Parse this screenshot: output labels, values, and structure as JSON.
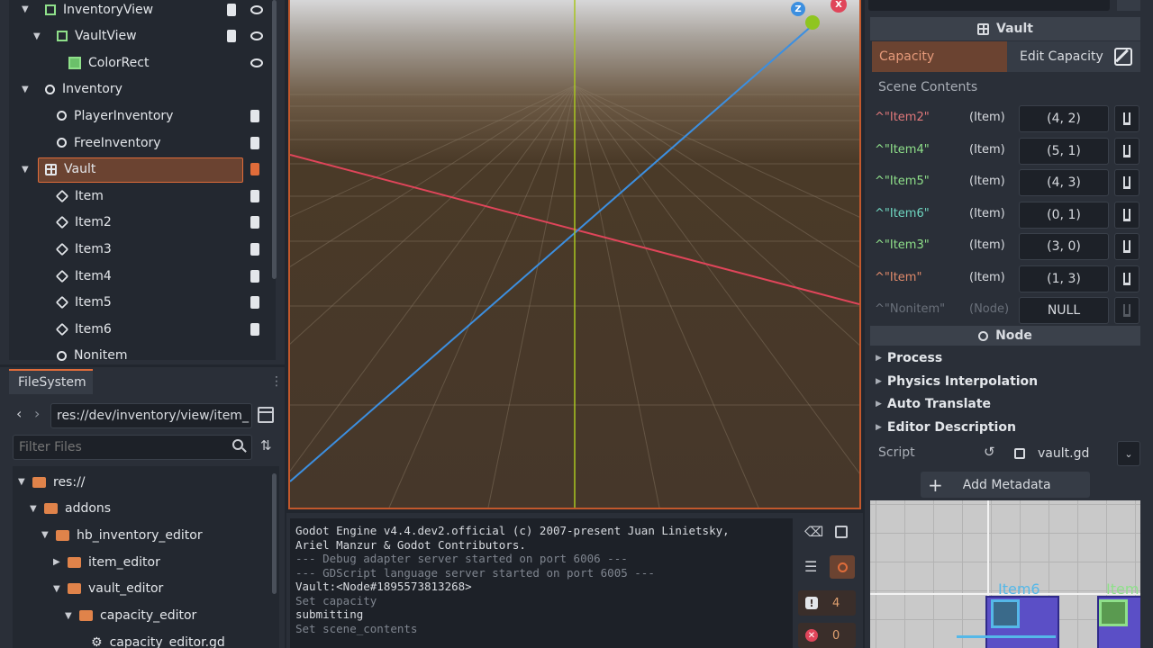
{
  "scene_tree": {
    "items": [
      {
        "label": "InventoryView",
        "icon": "control-node-icon",
        "depth": 1,
        "script": true,
        "visible": true,
        "expanded": true
      },
      {
        "label": "VaultView",
        "icon": "control-node-icon",
        "depth": 2,
        "script": true,
        "visible": true,
        "expanded": true
      },
      {
        "label": "ColorRect",
        "icon": "color-rect-icon",
        "depth": 3,
        "script": false,
        "visible": true
      },
      {
        "label": "Inventory",
        "icon": "node-icon",
        "depth": 1,
        "script": false,
        "visible": false,
        "expanded": true
      },
      {
        "label": "PlayerInventory",
        "icon": "node-icon",
        "depth": 2,
        "script": true,
        "visible": false
      },
      {
        "label": "FreeInventory",
        "icon": "node-icon",
        "depth": 2,
        "script": true,
        "visible": false
      },
      {
        "label": "Vault",
        "icon": "grid-icon",
        "depth": 1,
        "script": true,
        "visible": false,
        "expanded": true,
        "selected": true
      },
      {
        "label": "Item",
        "icon": "cube-icon",
        "depth": 2,
        "script": true,
        "visible": false
      },
      {
        "label": "Item2",
        "icon": "cube-icon",
        "depth": 2,
        "script": true,
        "visible": false
      },
      {
        "label": "Item3",
        "icon": "cube-icon",
        "depth": 2,
        "script": true,
        "visible": false
      },
      {
        "label": "Item4",
        "icon": "cube-icon",
        "depth": 2,
        "script": true,
        "visible": false
      },
      {
        "label": "Item5",
        "icon": "cube-icon",
        "depth": 2,
        "script": true,
        "visible": false
      },
      {
        "label": "Item6",
        "icon": "cube-icon",
        "depth": 2,
        "script": true,
        "visible": false
      },
      {
        "label": "Nonitem",
        "icon": "node-icon",
        "depth": 2,
        "script": false,
        "visible": false
      }
    ]
  },
  "filesystem": {
    "tab_label": "FileSystem",
    "path": "res://dev/inventory/view/item_",
    "filter_placeholder": "Filter Files",
    "items": [
      {
        "label": "res://",
        "depth": 0,
        "type": "folder"
      },
      {
        "label": "addons",
        "depth": 1,
        "type": "folder"
      },
      {
        "label": "hb_inventory_editor",
        "depth": 2,
        "type": "folder"
      },
      {
        "label": "item_editor",
        "depth": 3,
        "type": "folder",
        "collapsed": true
      },
      {
        "label": "vault_editor",
        "depth": 3,
        "type": "folder"
      },
      {
        "label": "capacity_editor",
        "depth": 4,
        "type": "folder"
      },
      {
        "label": "capacity_editor.gd",
        "depth": 5,
        "type": "script"
      }
    ]
  },
  "output": {
    "lines": [
      {
        "text": "Godot Engine v4.4.dev2.official (c) 2007-present Juan Linietsky,",
        "style": "bright"
      },
      {
        "text": "Ariel Manzur & Godot Contributors.",
        "style": "bright"
      },
      {
        "text": "--- Debug adapter server started on port 6006 ---",
        "style": "dim"
      },
      {
        "text": "--- GDScript language server started on port 6005 ---",
        "style": "dim"
      },
      {
        "text": "Vault:<Node#1895573813268>",
        "style": "bright"
      },
      {
        "text": "Set capacity",
        "style": "dim"
      },
      {
        "text": "submitting",
        "style": "bright"
      },
      {
        "text": "Set scene_contents",
        "style": "dim"
      }
    ],
    "warning_count": "4",
    "error_count": "0"
  },
  "inspector": {
    "node_title": "Vault",
    "capacity_label": "Capacity",
    "edit_capacity_label": "Edit Capacity",
    "scene_contents_label": "Scene Contents",
    "contents": [
      {
        "name": "^\"Item2\"",
        "type": "(Item)",
        "value": "(4, 2)",
        "color": "#e0787a"
      },
      {
        "name": "^\"Item4\"",
        "type": "(Item)",
        "value": "(5, 1)",
        "color": "#8fe08a"
      },
      {
        "name": "^\"Item5\"",
        "type": "(Item)",
        "value": "(4, 3)",
        "color": "#8fe08a"
      },
      {
        "name": "^\"Item6\"",
        "type": "(Item)",
        "value": "(0, 1)",
        "color": "#6fd6c0"
      },
      {
        "name": "^\"Item3\"",
        "type": "(Item)",
        "value": "(3, 0)",
        "color": "#8fe08a"
      },
      {
        "name": "^\"Item\"",
        "type": "(Item)",
        "value": "(1, 3)",
        "color": "#e08a6a"
      },
      {
        "name": "^\"Nonitem\"",
        "type": "(Node)",
        "value": "NULL",
        "color": "#6a707a"
      }
    ],
    "node_section": "Node",
    "sections": [
      "Process",
      "Physics Interpolation",
      "Auto Translate",
      "Editor Description"
    ],
    "script_label": "Script",
    "script_value": "vault.gd",
    "add_metadata": "Add Metadata",
    "preview_labels": [
      "Item6",
      "Item"
    ]
  },
  "colors": {
    "accent": "#e06c3a",
    "selected_bg": "#6b4331",
    "x_axis": "#e0455a",
    "z_axis": "#3c8fe0",
    "y_axis": "#a8c520",
    "viewport_bg": "#4a3a28"
  }
}
